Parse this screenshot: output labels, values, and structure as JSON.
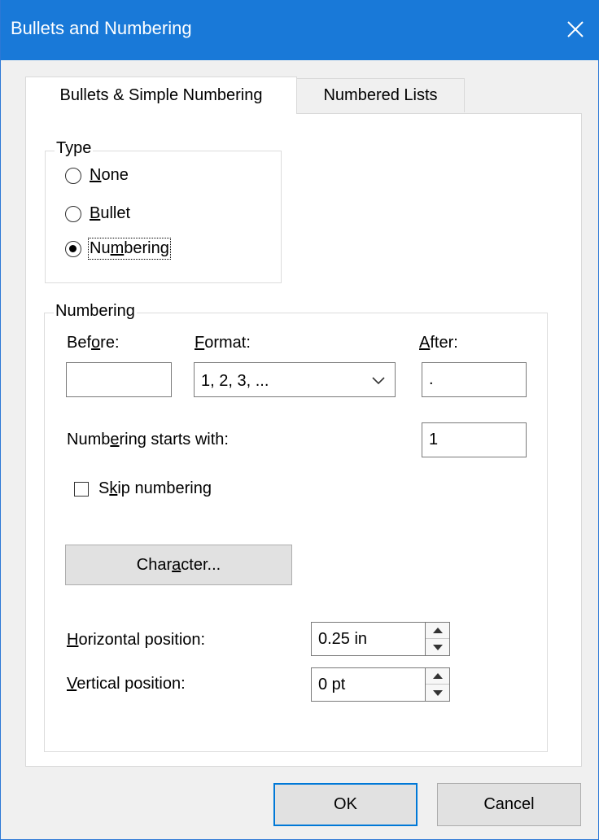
{
  "window": {
    "title": "Bullets and Numbering",
    "close_icon": "close-icon"
  },
  "tabs": [
    {
      "label": "Bullets & Simple Numbering",
      "active": true
    },
    {
      "label": "Numbered Lists",
      "active": false
    }
  ],
  "type_group": {
    "label": "Type",
    "options": [
      {
        "pre": "",
        "u": "N",
        "post": "one",
        "checked": false
      },
      {
        "pre": "",
        "u": "B",
        "post": "ullet",
        "checked": false
      },
      {
        "pre": "Nu",
        "u": "m",
        "post": "bering",
        "checked": true
      }
    ]
  },
  "numbering_group": {
    "label": "Numbering",
    "before": {
      "pre": "Bef",
      "u": "o",
      "post": "re:",
      "value": ""
    },
    "format": {
      "pre": "",
      "u": "F",
      "post": "ormat:",
      "value": "1, 2, 3, ..."
    },
    "after": {
      "pre": "",
      "u": "A",
      "post": "fter:",
      "value": "."
    },
    "starts_with": {
      "pre": "Numb",
      "u": "e",
      "post": "ring starts with:",
      "value": "1"
    },
    "skip": {
      "pre": "S",
      "u": "k",
      "post": "ip numbering",
      "checked": false
    },
    "character_button": {
      "pre": "Char",
      "u": "a",
      "post": "cter..."
    },
    "horizontal": {
      "pre": "",
      "u": "H",
      "post": "orizontal position:",
      "value": "0.25 in"
    },
    "vertical": {
      "pre": "",
      "u": "V",
      "post": "ertical position:",
      "value": "0 pt"
    }
  },
  "buttons": {
    "ok": "OK",
    "cancel": "Cancel"
  },
  "colors": {
    "titlebar": "#1979d8",
    "accent": "#0078d7",
    "dialog_bg": "#f0f0f0"
  }
}
